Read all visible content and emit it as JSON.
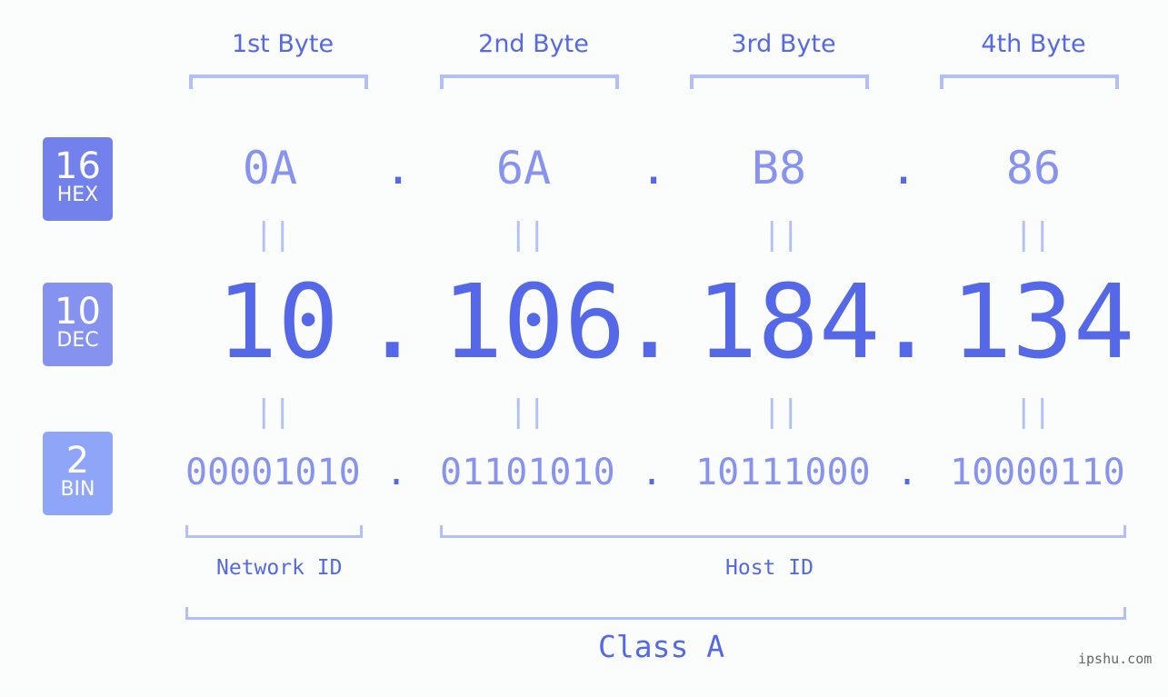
{
  "bytes": {
    "labels": [
      "1st Byte",
      "2nd Byte",
      "3rd Byte",
      "4th Byte"
    ]
  },
  "badges": {
    "hex": {
      "num": "16",
      "label": "HEX",
      "color": "#7281eb"
    },
    "dec": {
      "num": "10",
      "label": "DEC",
      "color": "#8592f0"
    },
    "bin": {
      "num": "2",
      "label": "BIN",
      "color": "#8fa6f8"
    }
  },
  "hex": [
    "0A",
    "6A",
    "B8",
    "86"
  ],
  "dec": [
    "10",
    "106",
    "184",
    "134"
  ],
  "bin": [
    "00001010",
    "01101010",
    "10111000",
    "10000110"
  ],
  "separator": ".",
  "equals": "||",
  "ids": {
    "network": "Network ID",
    "host": "Host ID"
  },
  "class_label": "Class A",
  "watermark": "ipshu.com"
}
